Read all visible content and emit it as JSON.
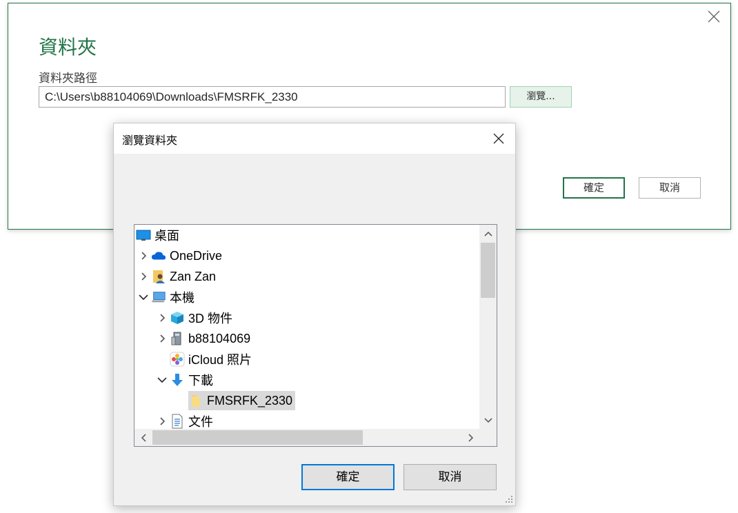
{
  "folder_dialog": {
    "title": "資料夾",
    "path_label": "資料夾路徑",
    "path_value": "C:\\Users\\b88104069\\Downloads\\FMSRFK_2330",
    "browse_label": "瀏覽...",
    "ok_label": "確定",
    "cancel_label": "取消",
    "accent_color": "#217346"
  },
  "browse_dialog": {
    "title": "瀏覽資料夾",
    "ok_label": "確定",
    "cancel_label": "取消",
    "tree": [
      {
        "label": "桌面",
        "icon": "desktop-icon",
        "expander": "none"
      },
      {
        "label": "OneDrive",
        "icon": "onedrive-cloud-icon",
        "expander": "collapsed"
      },
      {
        "label": "Zan Zan",
        "icon": "user-folder-icon",
        "expander": "collapsed"
      },
      {
        "label": "本機",
        "icon": "this-pc-icon",
        "expander": "expanded"
      },
      {
        "label": "3D 物件",
        "icon": "3d-objects-icon",
        "expander": "collapsed"
      },
      {
        "label": "b88104069",
        "icon": "user-files-icon",
        "expander": "collapsed"
      },
      {
        "label": "iCloud 照片",
        "icon": "icloud-photos-icon",
        "expander": "none"
      },
      {
        "label": "下載",
        "icon": "downloads-arrow-icon",
        "expander": "expanded"
      },
      {
        "label": "FMSRFK_2330",
        "icon": "folder-icon",
        "expander": "none",
        "selected": true
      },
      {
        "label": "文件",
        "icon": "documents-icon",
        "expander": "collapsed"
      }
    ]
  }
}
